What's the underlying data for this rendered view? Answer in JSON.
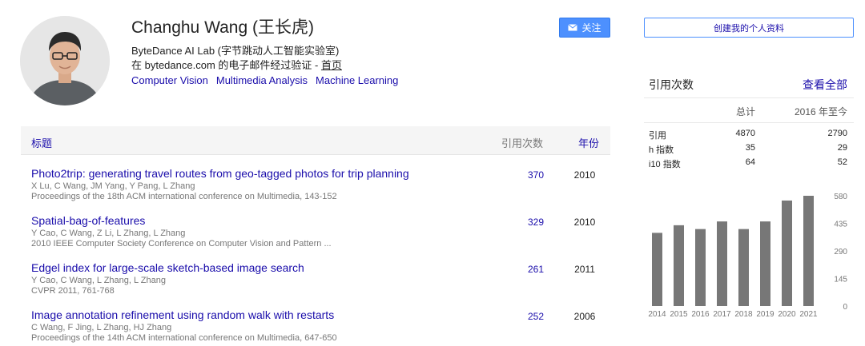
{
  "profile": {
    "name": "Changhu Wang (王长虎)",
    "affiliation": "ByteDance AI Lab (字节跳动人工智能实验室)",
    "email_prefix": "在 bytedance.com 的电子邮件经过验证 - ",
    "homepage_label": "首页",
    "interests": [
      "Computer Vision",
      "Multimedia Analysis",
      "Machine Learning"
    ]
  },
  "follow_button": {
    "label": "关注",
    "icon": "envelope-icon"
  },
  "create_profile_button": {
    "label": "创建我的个人资料"
  },
  "table": {
    "headers": {
      "title": "标题",
      "citations": "引用次数",
      "year": "年份"
    },
    "articles": [
      {
        "title": "Photo2trip: generating travel routes from geo-tagged photos for trip planning",
        "authors": "X Lu, C Wang, JM Yang, Y Pang, L Zhang",
        "venue": "Proceedings of the 18th ACM international conference on Multimedia, 143-152",
        "citations": "370",
        "year": "2010"
      },
      {
        "title": "Spatial-bag-of-features",
        "authors": "Y Cao, C Wang, Z Li, L Zhang, L Zhang",
        "venue": "2010 IEEE Computer Society Conference on Computer Vision and Pattern ...",
        "citations": "329",
        "year": "2010"
      },
      {
        "title": "Edgel index for large-scale sketch-based image search",
        "authors": "Y Cao, C Wang, L Zhang, L Zhang",
        "venue": "CVPR 2011, 761-768",
        "citations": "261",
        "year": "2011"
      },
      {
        "title": "Image annotation refinement using random walk with restarts",
        "authors": "C Wang, F Jing, L Zhang, HJ Zhang",
        "venue": "Proceedings of the 14th ACM international conference on Multimedia, 647-650",
        "citations": "252",
        "year": "2006"
      }
    ]
  },
  "citations": {
    "heading": "引用次数",
    "view_all": "查看全部",
    "columns": {
      "total": "总计",
      "since": "2016 年至今"
    },
    "rows": [
      {
        "label": "引用",
        "total": "4870",
        "since": "2790"
      },
      {
        "label": "h 指数",
        "total": "35",
        "since": "29"
      },
      {
        "label": "i10 指数",
        "total": "64",
        "since": "52"
      }
    ]
  },
  "colors": {
    "link": "#1a0dab",
    "button_blue": "#4d90fe",
    "bar": "#777777"
  },
  "chart_data": {
    "type": "bar",
    "categories": [
      "2014",
      "2015",
      "2016",
      "2017",
      "2018",
      "2019",
      "2020",
      "2021"
    ],
    "values": [
      385,
      425,
      405,
      445,
      405,
      445,
      555,
      580
    ],
    "yticks": [
      "580",
      "435",
      "290",
      "145",
      "0"
    ],
    "ylim": [
      0,
      580
    ],
    "title": "",
    "xlabel": "",
    "ylabel": "",
    "grid": false,
    "legend": "none"
  }
}
